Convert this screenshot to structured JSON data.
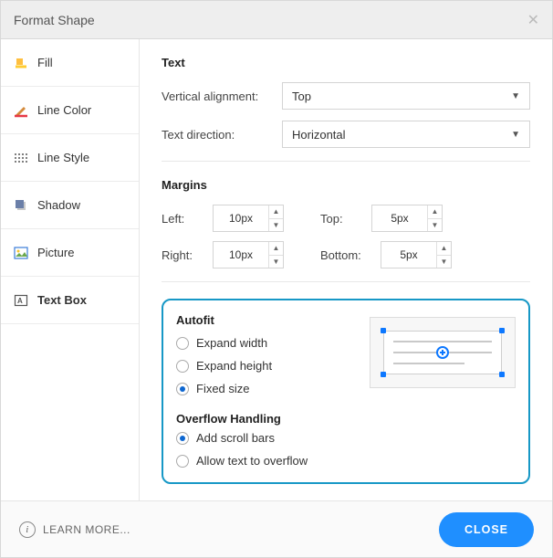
{
  "title": "Format Shape",
  "sidebar": {
    "items": [
      {
        "label": "Fill",
        "icon": "fill-icon"
      },
      {
        "label": "Line Color",
        "icon": "line-color-icon"
      },
      {
        "label": "Line Style",
        "icon": "line-style-icon"
      },
      {
        "label": "Shadow",
        "icon": "shadow-icon"
      },
      {
        "label": "Picture",
        "icon": "picture-icon"
      },
      {
        "label": "Text Box",
        "icon": "text-box-icon"
      }
    ],
    "active_index": 5
  },
  "sections": {
    "text": {
      "title": "Text",
      "valign_label": "Vertical alignment:",
      "valign_value": "Top",
      "direction_label": "Text direction:",
      "direction_value": "Horizontal"
    },
    "margins": {
      "title": "Margins",
      "left_label": "Left:",
      "left_value": "10px",
      "right_label": "Right:",
      "right_value": "10px",
      "top_label": "Top:",
      "top_value": "5px",
      "bottom_label": "Bottom:",
      "bottom_value": "5px"
    },
    "autofit": {
      "title": "Autofit",
      "options": [
        "Expand width",
        "Expand height",
        "Fixed size"
      ],
      "selected": 2
    },
    "overflow": {
      "title": "Overflow Handling",
      "options": [
        "Add scroll bars",
        "Allow text to overflow"
      ],
      "selected": 0
    }
  },
  "footer": {
    "learn_more": "LEARN MORE...",
    "close": "CLOSE"
  }
}
